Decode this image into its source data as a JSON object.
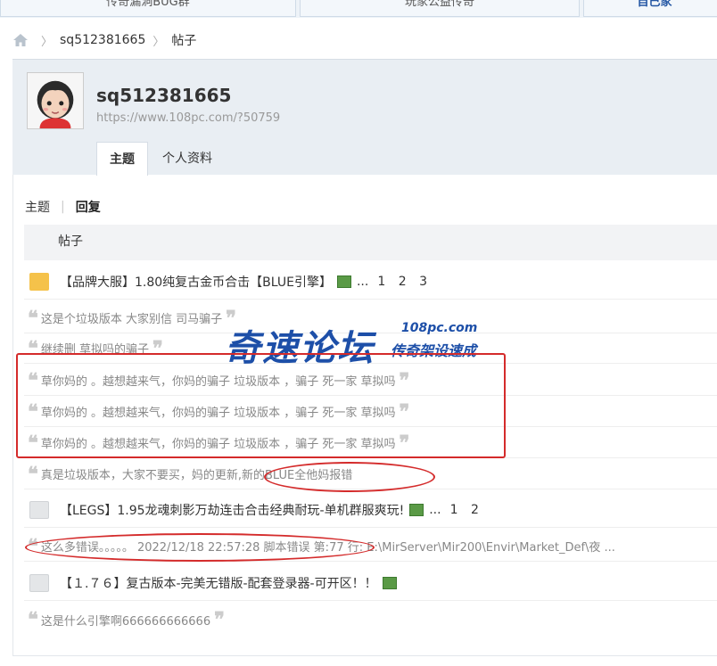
{
  "topnav": {
    "tabs": [
      "传奇漏洞BUG群",
      "玩家公益传奇",
      "自己家"
    ]
  },
  "breadcrumb": {
    "user": "sq512381665",
    "page": "帖子"
  },
  "profile": {
    "username": "sq512381665",
    "url": "https://www.108pc.com/?50759",
    "tabs": [
      "主题",
      "个人资料"
    ]
  },
  "subtabs": [
    "主题",
    "回复"
  ],
  "table": {
    "header": "帖子"
  },
  "threads": [
    {
      "title": "【品牌大服】1.80纯复古金币合击【BLUE引擎】",
      "more": "...",
      "pages": [
        "1",
        "2",
        "3"
      ]
    },
    {
      "title": "【LEGS】1.95龙魂刺影万劫连击合击经典耐玩-单机群服爽玩!",
      "more": "...",
      "pages": [
        "1",
        "2"
      ]
    },
    {
      "title": "【１.７６】复古版本-完美无错版-配套登录器-可开区！！"
    }
  ],
  "replies": [
    "这是个垃圾版本 大家别信 司马骗子",
    "继续删 草拟吗的骗子",
    "草你妈的 。越想越来气，你妈的骗子 垃圾版本 ，骗子 死一家 草拟吗",
    "草你妈的 。越想越来气，你妈的骗子 垃圾版本 ，骗子 死一家 草拟吗",
    "草你妈的 。越想越来气，你妈的骗子 垃圾版本 ，骗子 死一家 草拟吗",
    "真是垃圾版本，大家不要买，妈的更新,新的BLUE全他妈报错",
    "这么多错误。。。。。 2022/12/18 22:57:28 脚本错误 第:77 行: E:\\MirServer\\Mir200\\Envir\\Market_Def\\夜 ...",
    "这是什么引擎啊666666666666"
  ],
  "watermark": {
    "main": "奇速论坛",
    "url": "108pc.com",
    "sub": "传奇架设速成"
  },
  "quote_open": "❝",
  "quote_close": "❞",
  "colors": {
    "accent": "#1d4fa8",
    "annotation": "#d42b2b",
    "folder_hot": "#f5c24a"
  }
}
